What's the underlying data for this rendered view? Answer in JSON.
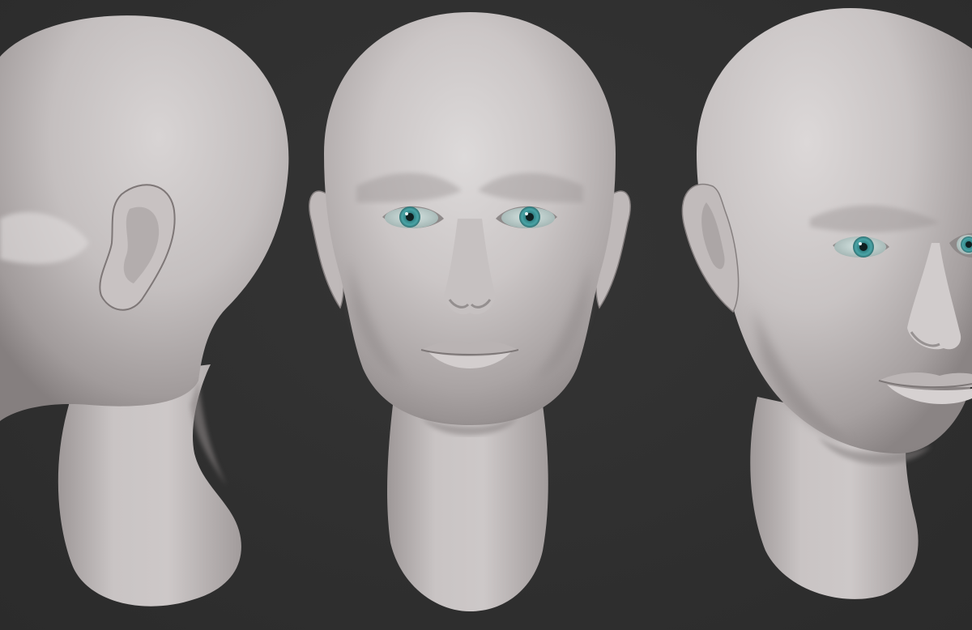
{
  "scene": {
    "background_color": "#303030",
    "clay_color": "#c9c4c4",
    "eye_color": "#3f9a9c",
    "views": [
      {
        "view": "back-three-quarter"
      },
      {
        "view": "front"
      },
      {
        "view": "front-three-quarter"
      }
    ]
  }
}
